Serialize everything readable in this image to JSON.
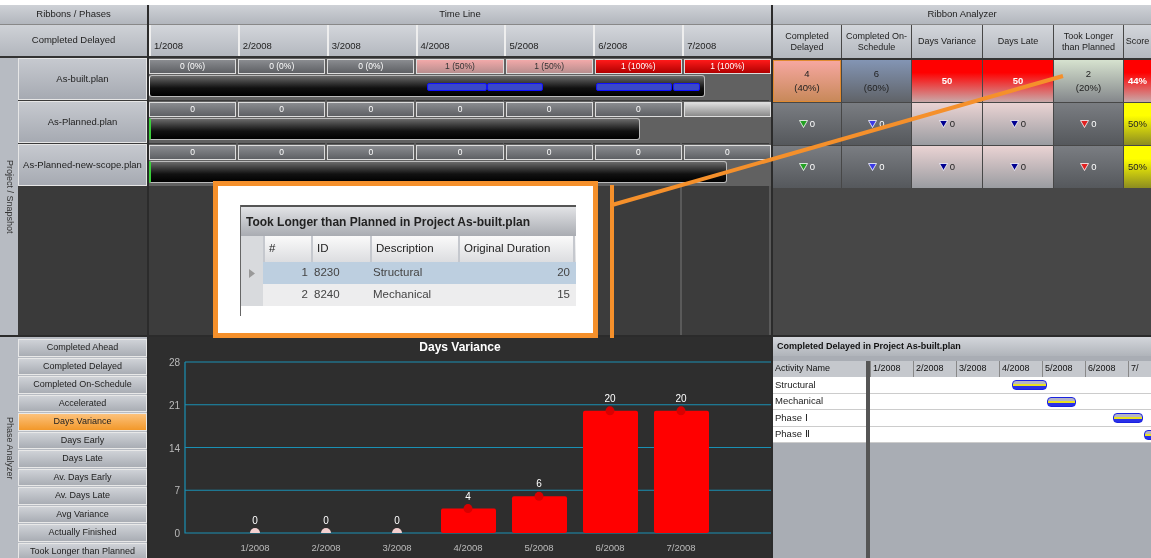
{
  "ribbons_header": "Ribbons / Phases",
  "metric": "Completed Delayed",
  "side_label": "Project / Snapshot",
  "timeline": {
    "title": "Time Line",
    "months": [
      "1/2008",
      "2/2008",
      "3/2008",
      "4/2008",
      "5/2008",
      "6/2008",
      "7/2008"
    ]
  },
  "analyzer": {
    "title": "Ribbon Analyzer",
    "columns": [
      "Completed Delayed",
      "Completed On-Schedule",
      "Days Variance",
      "Days Late",
      "Took Longer than Planned",
      "Score"
    ]
  },
  "projects": [
    {
      "name": "As-built.plan",
      "kind": "actual",
      "level": 0.894,
      "cells": [
        {
          "text": "0 (0%)",
          "kind": "neutral"
        },
        {
          "text": "0 (0%)",
          "kind": "neutral"
        },
        {
          "text": "0 (0%)",
          "kind": "neutral"
        },
        {
          "text": "1 (50%)",
          "kind": "partial"
        },
        {
          "text": "1 (50%)",
          "kind": "partial"
        },
        {
          "text": "1 (100%)",
          "kind": "full"
        },
        {
          "text": "1 (100%)",
          "kind": "full"
        }
      ],
      "analysis": [
        {
          "value": "4",
          "share": "(40%)",
          "kind": "orange"
        },
        {
          "value": "6",
          "share": "(60%)",
          "kind": "slate"
        },
        {
          "value": "50",
          "kind": "red"
        },
        {
          "value": "50",
          "kind": "red"
        },
        {
          "value": "2",
          "share": "(20%)",
          "kind": "green"
        },
        {
          "value": "44%",
          "kind": "red"
        }
      ]
    },
    {
      "name": "As-Planned.plan",
      "kind": "planned",
      "level": 0.79,
      "cells": [
        {
          "text": "0",
          "kind": "neutral"
        },
        {
          "text": "0",
          "kind": "neutral"
        },
        {
          "text": "0",
          "kind": "neutral"
        },
        {
          "text": "0",
          "kind": "neutral"
        },
        {
          "text": "0",
          "kind": "neutral"
        },
        {
          "text": "0",
          "kind": "neutral"
        },
        {
          "kind": "blank"
        }
      ],
      "analysis": [
        {
          "color": "#22a022",
          "value": "0",
          "kind": "gray"
        },
        {
          "color": "#3a3ae6",
          "value": "0",
          "kind": "gray"
        },
        {
          "color": "#000090",
          "value": "0",
          "kind": "pink"
        },
        {
          "color": "#000090",
          "value": "0",
          "kind": "pink"
        },
        {
          "color": "#e02020",
          "value": "0",
          "kind": "gray"
        },
        {
          "value": "50%",
          "kind": "yellow"
        }
      ]
    },
    {
      "name": "As-Planned-new-scope.plan",
      "kind": "planned",
      "level": 0.93,
      "cells": [
        {
          "text": "0",
          "kind": "neutral"
        },
        {
          "text": "0",
          "kind": "neutral"
        },
        {
          "text": "0",
          "kind": "neutral"
        },
        {
          "text": "0",
          "kind": "neutral"
        },
        {
          "text": "0",
          "kind": "neutral"
        },
        {
          "text": "0",
          "kind": "neutral"
        },
        {
          "text": "0",
          "kind": "neutral"
        }
      ],
      "analysis": [
        {
          "color": "#22a022",
          "value": "0",
          "kind": "gray"
        },
        {
          "color": "#3a3ae6",
          "value": "0",
          "kind": "gray"
        },
        {
          "color": "#000090",
          "value": "0",
          "kind": "pink"
        },
        {
          "color": "#000090",
          "value": "0",
          "kind": "pink"
        },
        {
          "color": "#e02020",
          "value": "0",
          "kind": "gray"
        },
        {
          "value": "50%",
          "kind": "yellow"
        }
      ]
    }
  ],
  "popup": {
    "title": "Took Longer than Planned in Project As-built.plan",
    "columns": [
      "#",
      "ID",
      "Description",
      "Original Duration"
    ],
    "rows": [
      {
        "number": "1",
        "id": "8230",
        "description": "Structural",
        "duration": "20",
        "selected": true
      },
      {
        "number": "2",
        "id": "8240",
        "description": "Mechanical",
        "duration": "15",
        "selected": false
      }
    ]
  },
  "phase_analyzer": {
    "label": "Phase Analyzer",
    "items": [
      {
        "label": "Completed Ahead",
        "selected": false
      },
      {
        "label": "Completed Delayed",
        "selected": false
      },
      {
        "label": "Completed On-Schedule",
        "selected": false
      },
      {
        "label": "Accelerated",
        "selected": false
      },
      {
        "label": "Days Variance",
        "selected": true
      },
      {
        "label": "Days Early",
        "selected": false
      },
      {
        "label": "Days Late",
        "selected": false
      },
      {
        "label": "Av. Days Early",
        "selected": false
      },
      {
        "label": "Av. Days Late",
        "selected": false
      },
      {
        "label": "Avg Variance",
        "selected": false
      },
      {
        "label": "Actually Finished",
        "selected": false
      },
      {
        "label": "Took Longer than Planned",
        "selected": false
      }
    ]
  },
  "chart_panel": {
    "chart_data": {
      "type": "bar",
      "title": "Days Variance",
      "categories": [
        "1/2008",
        "2/2008",
        "3/2008",
        "4/2008",
        "5/2008",
        "6/2008",
        "7/2008"
      ],
      "series": [
        {
          "color": "#ff0000",
          "values": [
            0,
            0,
            0,
            4,
            6,
            20,
            20
          ]
        }
      ],
      "ylim": [
        0,
        28
      ],
      "yticks": [
        0,
        7,
        14,
        21,
        28
      ],
      "grid": true,
      "data_labels": true
    }
  },
  "detail": {
    "title": "Completed Delayed in Project As-built.plan",
    "name_column": "Activity Name",
    "months": [
      "1/2008",
      "2/2008",
      "3/2008",
      "4/2008",
      "5/2008",
      "6/2008",
      "7/"
    ],
    "rows": [
      {
        "name": "Structural"
      },
      {
        "name": "Mechanical"
      },
      {
        "name": "Phase Ⅰ"
      },
      {
        "name": "Phase Ⅱ"
      }
    ]
  }
}
